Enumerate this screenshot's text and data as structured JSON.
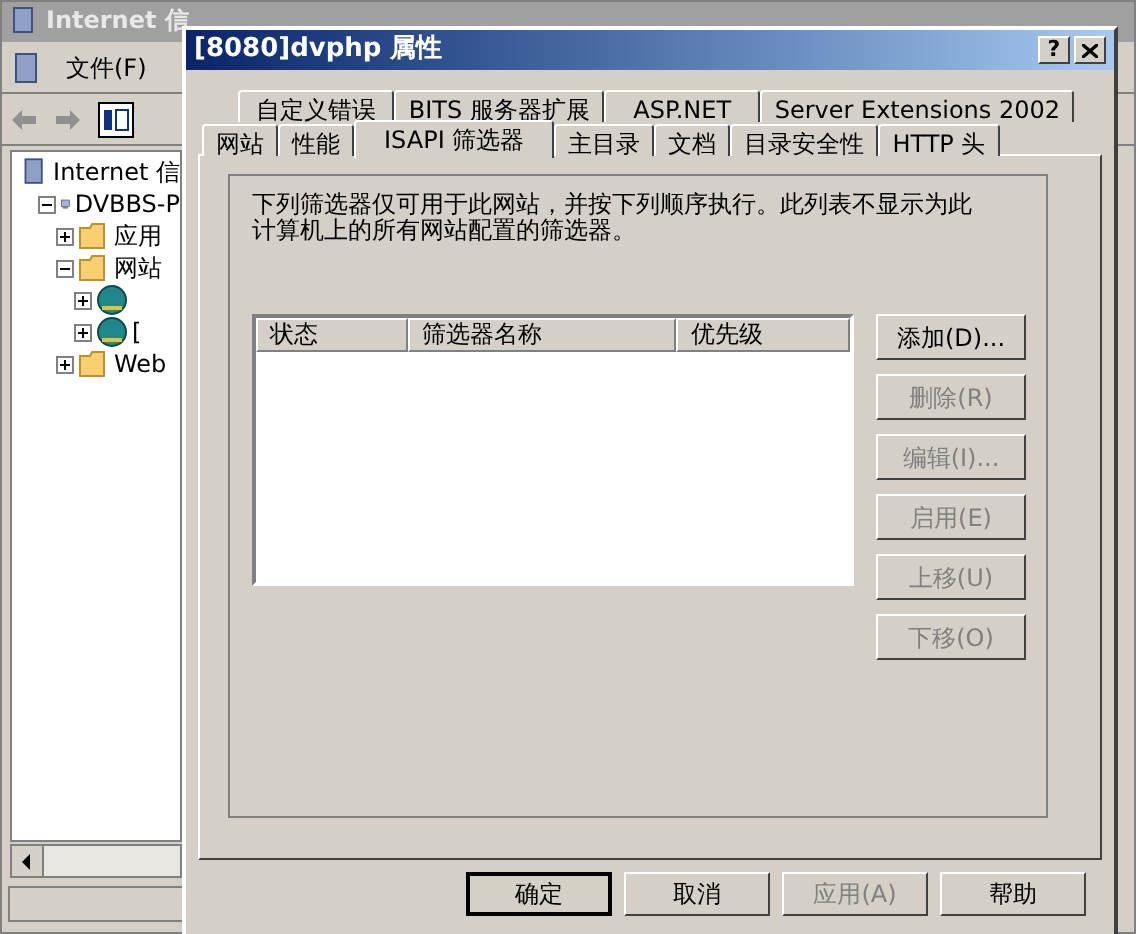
{
  "background_window": {
    "title": "Internet 信",
    "menu": [
      "文件(F)"
    ],
    "tree": [
      {
        "label": "Internet 信",
        "kind": "root",
        "children": [
          {
            "label": "DVBBS-P",
            "kind": "computer",
            "expanded": true,
            "children": [
              {
                "label": "应用",
                "kind": "folder",
                "expanded": false
              },
              {
                "label": "网站",
                "kind": "folder",
                "expanded": true,
                "children": [
                  {
                    "kind": "site",
                    "expanded": false
                  },
                  {
                    "label": "[",
                    "kind": "site",
                    "expanded": false
                  }
                ]
              },
              {
                "label": "Web",
                "kind": "folder",
                "expanded": false
              }
            ]
          }
        ]
      }
    ]
  },
  "dialog": {
    "title": "[8080]dvphp 属性",
    "help_button": "?",
    "tab_rows": [
      [
        {
          "label": "自定义错误",
          "selected": false
        },
        {
          "label": "BITS 服务器扩展",
          "selected": false
        },
        {
          "label": "ASP.NET",
          "selected": false
        },
        {
          "label": "Server Extensions 2002",
          "selected": false
        }
      ],
      [
        {
          "label": "网站",
          "selected": false
        },
        {
          "label": "性能",
          "selected": false
        },
        {
          "label": "ISAPI 筛选器",
          "selected": true
        },
        {
          "label": "主目录",
          "selected": false
        },
        {
          "label": "文档",
          "selected": false
        },
        {
          "label": "目录安全性",
          "selected": false
        },
        {
          "label": "HTTP 头",
          "selected": false
        }
      ]
    ],
    "description": "下列筛选器仅可用于此网站，并按下列顺序执行。此列表不显示为此计算机上的所有网站配置的筛选器。",
    "list": {
      "columns": [
        "状态",
        "筛选器名称",
        "优先级"
      ]
    },
    "side_buttons": [
      {
        "label": "添加(D)...",
        "disabled": false
      },
      {
        "label": "删除(R)",
        "disabled": true
      },
      {
        "label": "编辑(I)...",
        "disabled": true
      },
      {
        "label": "启用(E)",
        "disabled": true
      },
      {
        "label": "上移(U)",
        "disabled": true
      },
      {
        "label": "下移(O)",
        "disabled": true
      }
    ],
    "buttons": [
      {
        "label": "确定",
        "disabled": false,
        "default": true
      },
      {
        "label": "取消",
        "disabled": false,
        "default": false
      },
      {
        "label": "应用(A)",
        "disabled": true,
        "default": false
      },
      {
        "label": "帮助",
        "disabled": false,
        "default": false
      }
    ]
  }
}
